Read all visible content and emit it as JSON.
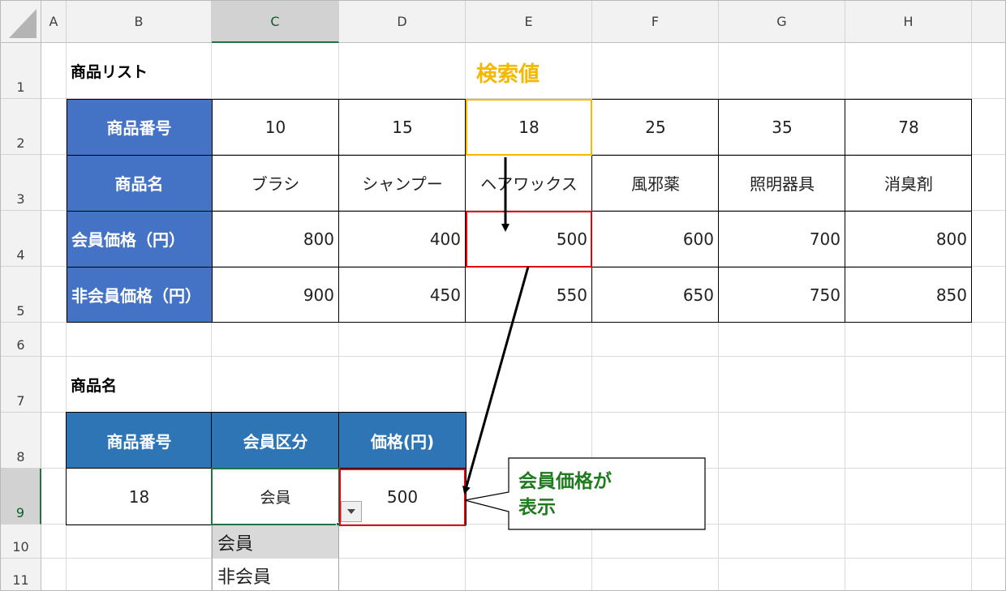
{
  "columns": [
    "A",
    "B",
    "C",
    "D",
    "E",
    "F",
    "G",
    "H"
  ],
  "rows": [
    "1",
    "2",
    "3",
    "4",
    "5",
    "6",
    "7",
    "8",
    "9",
    "10",
    "11"
  ],
  "sheet": {
    "list_title": "商品リスト",
    "search_label": "検索値",
    "row2_header": "商品番号",
    "row3_header": "商品名",
    "row4_header": "会員価格（円）",
    "row5_header": "非会員価格（円）",
    "product_numbers": [
      "10",
      "15",
      "18",
      "25",
      "35",
      "78"
    ],
    "product_names": [
      "ブラシ",
      "シャンプー",
      "ヘアワックス",
      "風邪薬",
      "照明器具",
      "消臭剤"
    ],
    "member_prices": [
      "800",
      "400",
      "500",
      "600",
      "700",
      "800"
    ],
    "nonmember_prices": [
      "900",
      "450",
      "550",
      "650",
      "750",
      "850"
    ],
    "lookup_title": "商品名",
    "lookup_headers": [
      "商品番号",
      "会員区分",
      "価格(円)"
    ],
    "lookup_values": [
      "18",
      "会員",
      "500"
    ]
  },
  "dropdown": {
    "options": [
      "会員",
      "非会員"
    ],
    "selected": "会員"
  },
  "callout": {
    "line1": "会員価格が",
    "line2": "表示"
  },
  "colors": {
    "header_blue": "#4472c4",
    "header_blue2": "#2e75b6",
    "highlight_red": "#e3000f",
    "search_gold": "#f5b800",
    "callout_green": "#1e7b1e",
    "excel_green": "#217346"
  }
}
